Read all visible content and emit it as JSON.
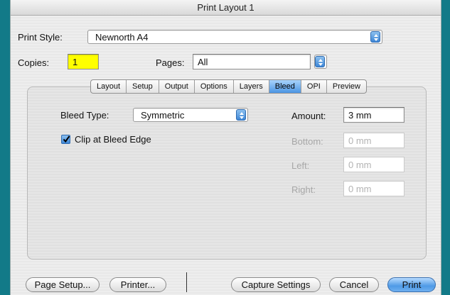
{
  "window": {
    "title": "Print Layout 1"
  },
  "print_style": {
    "label": "Print Style:",
    "value": "Newnorth A4"
  },
  "copies": {
    "label": "Copies:",
    "value": "1"
  },
  "pages": {
    "label": "Pages:",
    "value": "All"
  },
  "tabs": [
    {
      "label": "Layout",
      "active": false
    },
    {
      "label": "Setup",
      "active": false
    },
    {
      "label": "Output",
      "active": false
    },
    {
      "label": "Options",
      "active": false
    },
    {
      "label": "Layers",
      "active": false
    },
    {
      "label": "Bleed",
      "active": true
    },
    {
      "label": "OPI",
      "active": false
    },
    {
      "label": "Preview",
      "active": false
    }
  ],
  "bleed": {
    "type_label": "Bleed Type:",
    "type_value": "Symmetric",
    "clip_label": "Clip at Bleed Edge",
    "clip_checked": true,
    "amount_label": "Amount:",
    "amount_value": "3 mm",
    "bottom_label": "Bottom:",
    "bottom_value": "0 mm",
    "left_label": "Left:",
    "left_value": "0 mm",
    "right_label": "Right:",
    "right_value": "0 mm"
  },
  "buttons": {
    "page_setup": "Page Setup...",
    "printer": "Printer...",
    "capture": "Capture Settings",
    "cancel": "Cancel",
    "print": "Print"
  }
}
